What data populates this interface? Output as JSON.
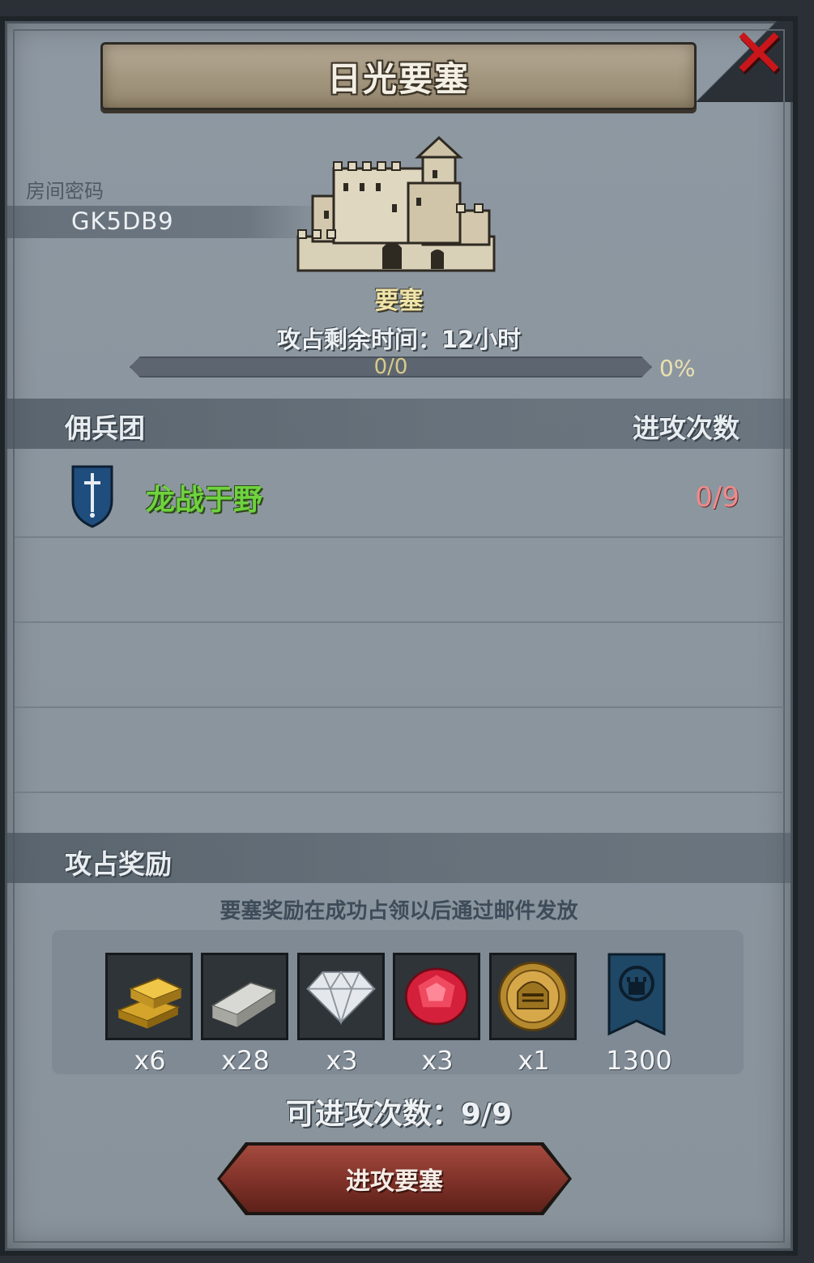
{
  "title": "日光要塞",
  "room": {
    "label": "房间密码",
    "code": "GK5DB9"
  },
  "fortress": {
    "type_label": "要塞",
    "time_remaining": "攻占剩余时间：12小时"
  },
  "progress": {
    "count": "0/0",
    "percent_text": "0%",
    "fraction": 0
  },
  "mercenary_section": {
    "title": "佣兵团",
    "attacks_header": "进攻次数"
  },
  "mercenaries": [
    {
      "name": "龙战于野",
      "attacks": "0/9",
      "icon": "sword-shield-icon"
    }
  ],
  "rewards_section": {
    "title": "攻占奖励",
    "note": "要塞奖励在成功占领以后通过邮件发放",
    "items": [
      {
        "icon": "gold-bars-icon",
        "qty": "x6"
      },
      {
        "icon": "iron-ingot-icon",
        "qty": "x28"
      },
      {
        "icon": "diamond-icon",
        "qty": "x3"
      },
      {
        "icon": "ruby-icon",
        "qty": "x3"
      },
      {
        "icon": "knight-helmet-coin-icon",
        "qty": "x1"
      },
      {
        "icon": "fortress-banner-icon",
        "qty": "1300"
      }
    ]
  },
  "attacks_available": "可进攻次数：9/9",
  "attack_button": "进攻要塞",
  "colors": {
    "merc_name": "#6fd23f",
    "attacks_count": "#f08a8a",
    "button": "#7e3128",
    "close": "#c8161b"
  }
}
